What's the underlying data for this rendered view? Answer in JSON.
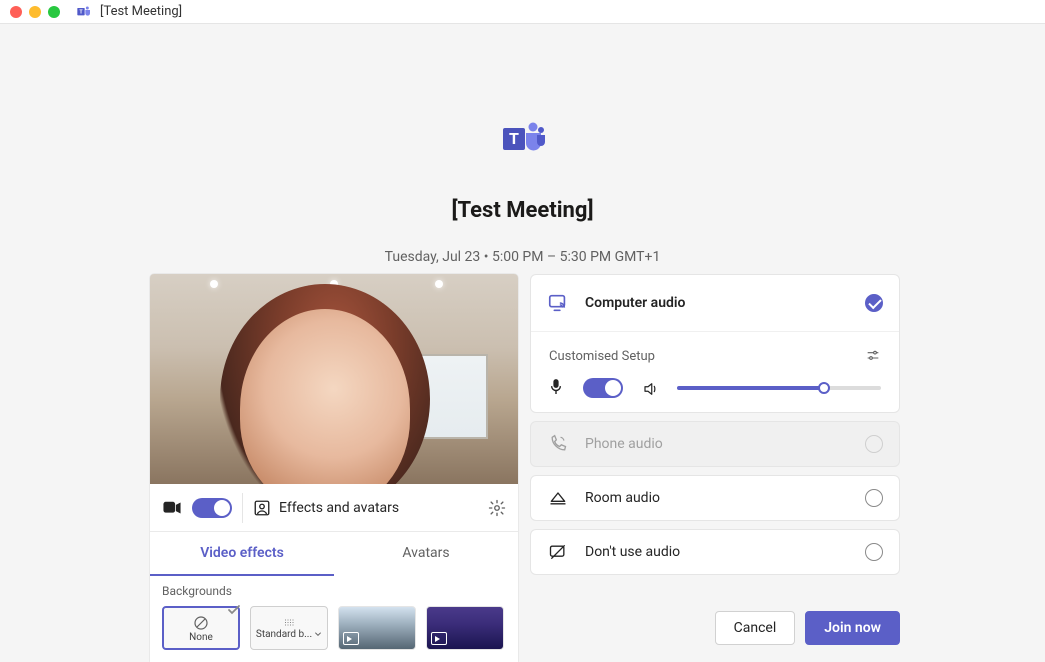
{
  "window": {
    "title": "[Test Meeting]"
  },
  "header": {
    "meeting_title": "[Test Meeting]",
    "meeting_time": "Tuesday, Jul 23  •  5:00 PM  –  5:30 PM  GMT+1"
  },
  "video": {
    "effects_label": "Effects and avatars",
    "tabs": {
      "video_effects": "Video effects",
      "avatars": "Avatars"
    },
    "backgrounds": {
      "section_label": "Backgrounds",
      "none_label": "None",
      "standard_blur_label": "Standard b..."
    }
  },
  "audio": {
    "computer_audio": "Computer audio",
    "customised_setup": "Customised Setup",
    "phone_audio": "Phone audio",
    "room_audio": "Room audio",
    "dont_use_audio": "Don't use audio",
    "volume_percent": 72
  },
  "actions": {
    "cancel": "Cancel",
    "join_now": "Join now"
  },
  "colors": {
    "brand": "#5b5fc7"
  }
}
